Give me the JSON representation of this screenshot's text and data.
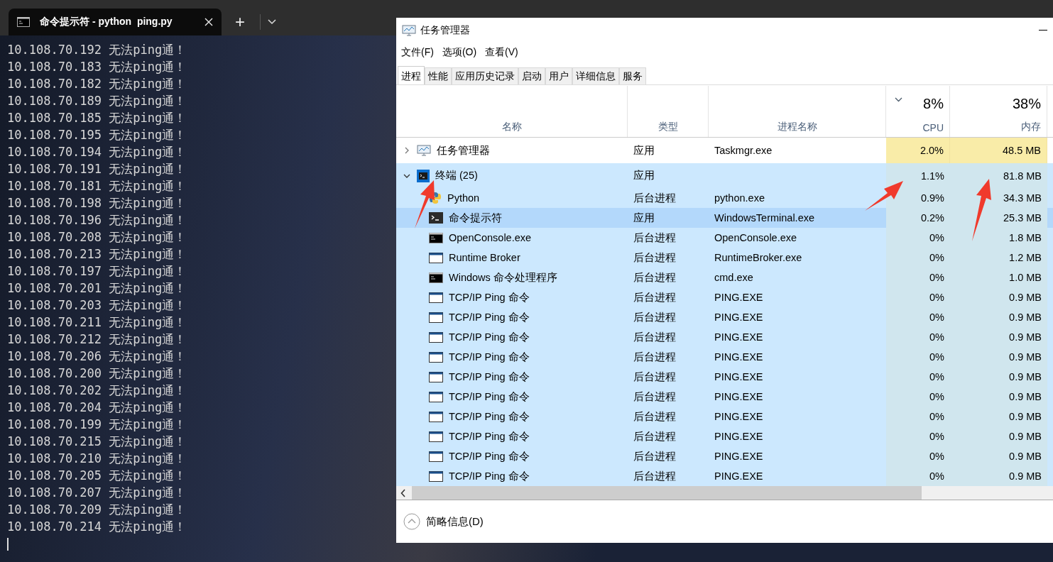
{
  "terminal": {
    "tab_title": "命令提示符 - python  ping.py",
    "new_tab": "+",
    "lines": [
      "10.108.70.192 无法ping通！",
      "10.108.70.183 无法ping通！",
      "10.108.70.182 无法ping通！",
      "10.108.70.189 无法ping通！",
      "10.108.70.185 无法ping通！",
      "10.108.70.195 无法ping通！",
      "10.108.70.194 无法ping通！",
      "10.108.70.191 无法ping通！",
      "10.108.70.181 无法ping通！",
      "10.108.70.198 无法ping通！",
      "10.108.70.196 无法ping通！",
      "10.108.70.208 无法ping通！",
      "10.108.70.213 无法ping通！",
      "10.108.70.197 无法ping通！",
      "10.108.70.201 无法ping通！",
      "10.108.70.203 无法ping通！",
      "10.108.70.211 无法ping通！",
      "10.108.70.212 无法ping通！",
      "10.108.70.206 无法ping通！",
      "10.108.70.200 无法ping通！",
      "10.108.70.202 无法ping通！",
      "10.108.70.204 无法ping通！",
      "10.108.70.199 无法ping通！",
      "10.108.70.215 无法ping通！",
      "10.108.70.210 无法ping通！",
      "10.108.70.205 无法ping通！",
      "10.108.70.207 无法ping通！",
      "10.108.70.209 无法ping通！",
      "10.108.70.214 无法ping通！"
    ]
  },
  "task_manager": {
    "title": "任务管理器",
    "menu": [
      "文件(F)",
      "选项(O)",
      "查看(V)"
    ],
    "tabs": [
      {
        "label": "进程",
        "selected": true
      },
      {
        "label": "性能",
        "selected": false
      },
      {
        "label": "应用历史记录",
        "selected": false
      },
      {
        "label": "启动",
        "selected": false
      },
      {
        "label": "用户",
        "selected": false
      },
      {
        "label": "详细信息",
        "selected": false
      },
      {
        "label": "服务",
        "selected": false
      }
    ],
    "columns": {
      "name": "名称",
      "type": "类型",
      "process_name": "进程名称",
      "cpu_total": "8%",
      "cpu": "CPU",
      "memory_total": "38%",
      "memory": "内存"
    },
    "processes": [
      {
        "kind": "monitor",
        "name": "任务管理器",
        "type": "应用",
        "process_name": "Taskmgr.exe",
        "cpu": "2.0%",
        "memory": "48.5 MB",
        "expanded": false,
        "selected": false
      },
      {
        "kind": "terminal",
        "name": "终端 (25)",
        "type": "应用",
        "cpu": "1.1%",
        "memory": "81.8 MB",
        "expanded": true,
        "selected": false,
        "children": [
          {
            "kind": "python",
            "name": "Python",
            "type": "后台进程",
            "process_name": "python.exe",
            "cpu": "0.9%",
            "memory": "34.3 MB",
            "selected": false
          },
          {
            "kind": "prompt",
            "name": "命令提示符",
            "type": "应用",
            "process_name": "WindowsTerminal.exe",
            "cpu": "0.2%",
            "memory": "25.3 MB",
            "selected": true
          },
          {
            "kind": "console",
            "name": "OpenConsole.exe",
            "type": "后台进程",
            "process_name": "OpenConsole.exe",
            "cpu": "0%",
            "memory": "1.8 MB",
            "selected": false
          },
          {
            "kind": "window",
            "name": "Runtime Broker",
            "type": "后台进程",
            "process_name": "RuntimeBroker.exe",
            "cpu": "0%",
            "memory": "1.2 MB",
            "selected": false
          },
          {
            "kind": "console",
            "name": "Windows 命令处理程序",
            "type": "后台进程",
            "process_name": "cmd.exe",
            "cpu": "0%",
            "memory": "1.0 MB",
            "selected": false
          },
          {
            "kind": "window",
            "name": "TCP/IP Ping 命令",
            "type": "后台进程",
            "process_name": "PING.EXE",
            "cpu": "0%",
            "memory": "0.9 MB",
            "selected": false
          },
          {
            "kind": "window",
            "name": "TCP/IP Ping 命令",
            "type": "后台进程",
            "process_name": "PING.EXE",
            "cpu": "0%",
            "memory": "0.9 MB",
            "selected": false
          },
          {
            "kind": "window",
            "name": "TCP/IP Ping 命令",
            "type": "后台进程",
            "process_name": "PING.EXE",
            "cpu": "0%",
            "memory": "0.9 MB",
            "selected": false
          },
          {
            "kind": "window",
            "name": "TCP/IP Ping 命令",
            "type": "后台进程",
            "process_name": "PING.EXE",
            "cpu": "0%",
            "memory": "0.9 MB",
            "selected": false
          },
          {
            "kind": "window",
            "name": "TCP/IP Ping 命令",
            "type": "后台进程",
            "process_name": "PING.EXE",
            "cpu": "0%",
            "memory": "0.9 MB",
            "selected": false
          },
          {
            "kind": "window",
            "name": "TCP/IP Ping 命令",
            "type": "后台进程",
            "process_name": "PING.EXE",
            "cpu": "0%",
            "memory": "0.9 MB",
            "selected": false
          },
          {
            "kind": "window",
            "name": "TCP/IP Ping 命令",
            "type": "后台进程",
            "process_name": "PING.EXE",
            "cpu": "0%",
            "memory": "0.9 MB",
            "selected": false
          },
          {
            "kind": "window",
            "name": "TCP/IP Ping 命令",
            "type": "后台进程",
            "process_name": "PING.EXE",
            "cpu": "0%",
            "memory": "0.9 MB",
            "selected": false
          },
          {
            "kind": "window",
            "name": "TCP/IP Ping 命令",
            "type": "后台进程",
            "process_name": "PING.EXE",
            "cpu": "0%",
            "memory": "0.9 MB",
            "selected": false
          },
          {
            "kind": "window",
            "name": "TCP/IP Ping 命令",
            "type": "后台进程",
            "process_name": "PING.EXE",
            "cpu": "0%",
            "memory": "0.9 MB",
            "selected": false
          }
        ]
      }
    ],
    "footer": "简略信息(D)"
  }
}
